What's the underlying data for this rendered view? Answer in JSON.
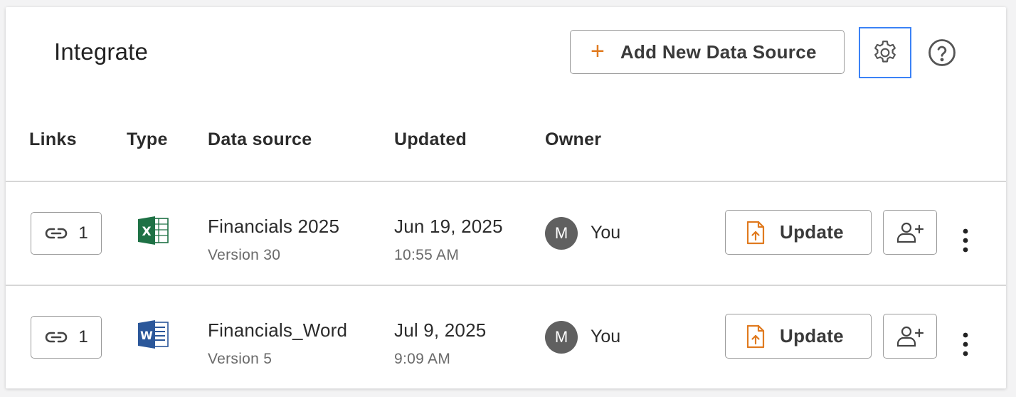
{
  "header": {
    "title": "Integrate",
    "add_button_label": "Add New Data Source",
    "add_icon": "plus-icon",
    "settings_icon": "gear-icon",
    "help_icon": "help-circle-icon"
  },
  "columns": [
    "Links",
    "Type",
    "Data source",
    "Updated",
    "Owner"
  ],
  "colors": {
    "accent": "#e07a1f",
    "focus": "#3b82f6",
    "excel": "#1e7145",
    "word": "#2b579a",
    "avatar": "#606060"
  },
  "rows": [
    {
      "links_count": "1",
      "type_icon": "excel-icon",
      "name": "Financials 2025",
      "version": "Version 30",
      "updated_date": "Jun 19, 2025",
      "updated_time": "10:55 AM",
      "owner_initial": "M",
      "owner_name": "You",
      "update_label": "Update"
    },
    {
      "links_count": "1",
      "type_icon": "word-icon",
      "name": "Financials_Word",
      "version": "Version 5",
      "updated_date": "Jul 9, 2025",
      "updated_time": "9:09 AM",
      "owner_initial": "M",
      "owner_name": "You",
      "update_label": "Update"
    }
  ]
}
